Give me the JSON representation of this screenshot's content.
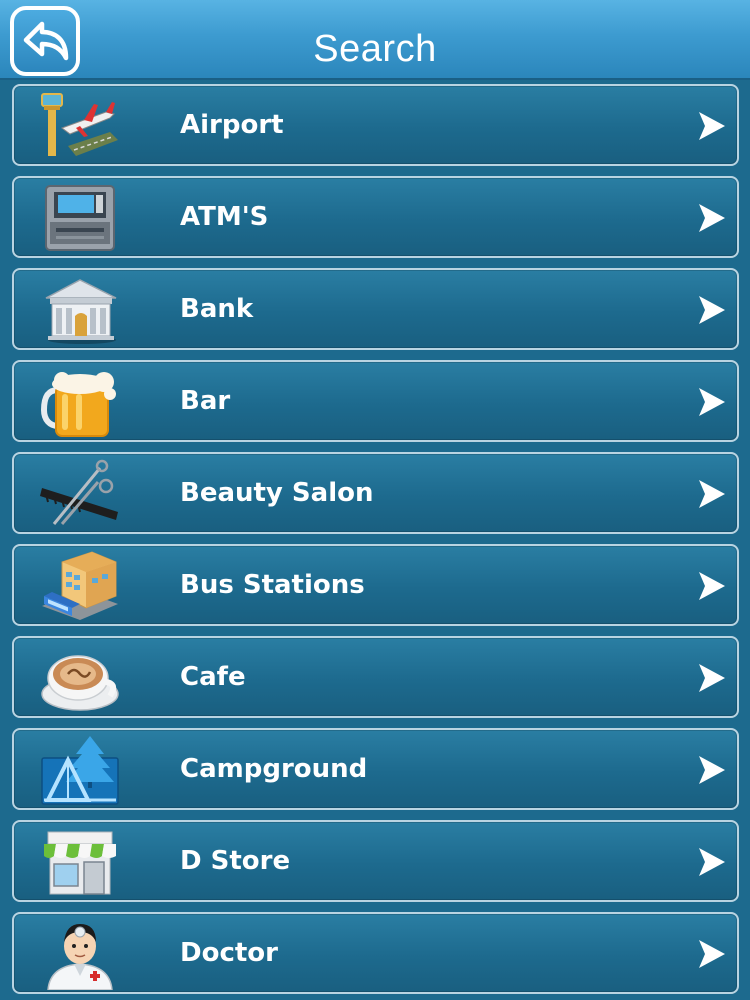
{
  "header": {
    "title": "Search",
    "back_icon": "back-arrow-icon"
  },
  "colors": {
    "header_top": "#58b3e3",
    "header_bottom": "#2b86bb",
    "background": "#1d6a8e",
    "row_border": "#b9d4e2",
    "text": "#ffffff"
  },
  "categories": [
    {
      "label": "Airport",
      "icon": "airport-icon"
    },
    {
      "label": "ATM'S",
      "icon": "atm-icon"
    },
    {
      "label": "Bank",
      "icon": "bank-icon"
    },
    {
      "label": "Bar",
      "icon": "beer-mug-icon"
    },
    {
      "label": "Beauty Salon",
      "icon": "comb-scissors-icon"
    },
    {
      "label": "Bus Stations",
      "icon": "bus-station-icon"
    },
    {
      "label": "Cafe",
      "icon": "coffee-cup-icon"
    },
    {
      "label": "Campground",
      "icon": "tent-tree-icon"
    },
    {
      "label": "D Store",
      "icon": "store-icon"
    },
    {
      "label": "Doctor",
      "icon": "doctor-icon"
    }
  ]
}
